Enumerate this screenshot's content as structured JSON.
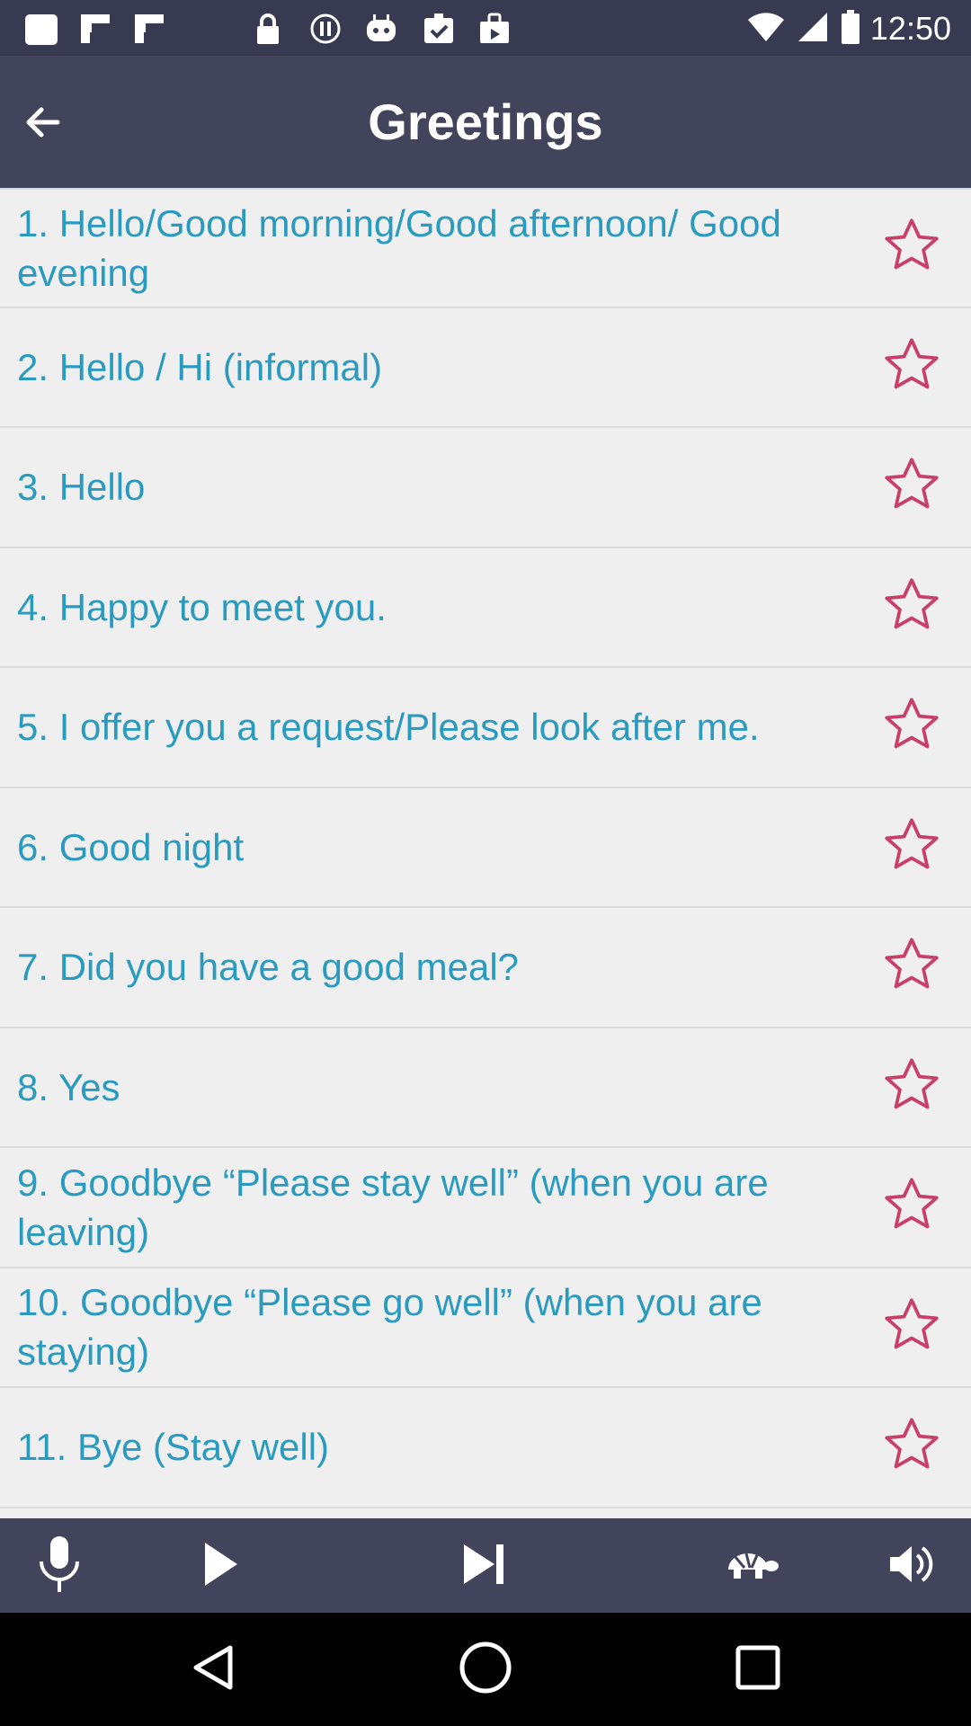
{
  "status_bar": {
    "time": "12:50",
    "left_icons": [
      "notification-square-icon",
      "flipboard-icon",
      "flipboard-icon",
      "lock-icon",
      "info-circle-icon",
      "robot-icon",
      "calendar-check-icon",
      "shopping-bag-icon"
    ],
    "right_icons": [
      "wifi-icon",
      "signal-icon",
      "battery-icon"
    ]
  },
  "header": {
    "title": "Greetings",
    "back_icon": "arrow-left-icon"
  },
  "phrases": [
    {
      "text": "1. Hello/Good morning/Good afternoon/ Good evening"
    },
    {
      "text": "2. Hello / Hi (informal)"
    },
    {
      "text": "3. Hello"
    },
    {
      "text": "4. Happy to meet you."
    },
    {
      "text": "5. I offer you a request/Please look after me."
    },
    {
      "text": "6. Good night"
    },
    {
      "text": "7. Did you have a good meal?"
    },
    {
      "text": "8. Yes"
    },
    {
      "text": "9. Goodbye “Please stay well” (when you are leaving)"
    },
    {
      "text": "10. Goodbye “Please go well” (when you are staying)"
    },
    {
      "text": "11. Bye (Stay well)"
    }
  ],
  "colors": {
    "app_bar": "#41445a",
    "status_bar": "#373a50",
    "phrase_text": "#2a9bbf",
    "star_outline": "#c8406a",
    "list_bg": "#efefef"
  },
  "player": {
    "icons": [
      "microphone-icon",
      "play-icon",
      "skip-next-icon",
      "turtle-slow-icon",
      "volume-icon"
    ]
  },
  "nav": {
    "icons": [
      "back-triangle-icon",
      "home-circle-icon",
      "recents-square-icon"
    ]
  }
}
